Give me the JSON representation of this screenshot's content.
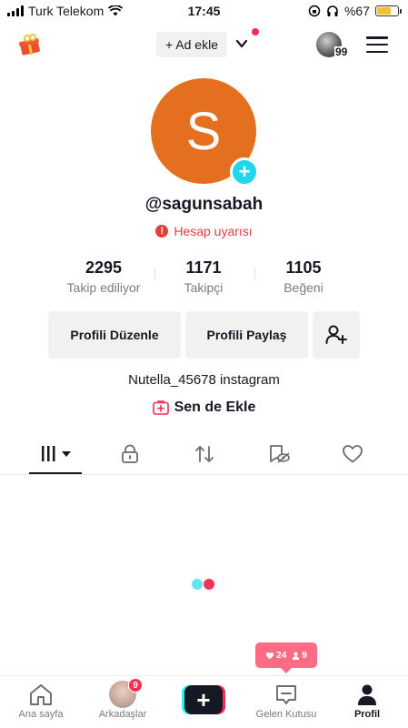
{
  "status_bar": {
    "carrier": "Turk Telekom",
    "time": "17:45",
    "battery_text": "%67",
    "battery_level": 0.67,
    "battery_color": "#f2c230"
  },
  "top_nav": {
    "gift_icon": "gift-icon",
    "add_account_label": "+ Ad ekle",
    "mini_avatar_count": "99"
  },
  "profile": {
    "avatar_initial": "S",
    "avatar_color": "#e4701f",
    "username": "@sagunsabah",
    "warning_label": "Hesap uyarısı",
    "stats": [
      {
        "value": "2295",
        "label": "Takip ediliyor"
      },
      {
        "value": "1171",
        "label": "Takipçi"
      },
      {
        "value": "1105",
        "label": "Beğeni"
      }
    ],
    "edit_button": "Profili Düzenle",
    "share_button": "Profili Paylaş",
    "bio": "Nutella_45678 instagram",
    "add_link": "Sen de Ekle"
  },
  "tabs": [
    "videos-grid-icon",
    "lock-icon",
    "repost-icon",
    "bookmark-eye-icon",
    "heart-icon"
  ],
  "popup": {
    "likes": "24",
    "followers": "9"
  },
  "bottom_nav": {
    "items": [
      {
        "label": "Ana sayfa",
        "icon": "home-icon"
      },
      {
        "label": "Arkadaşlar",
        "icon": "friends-avatar",
        "badge": "9"
      },
      {
        "label": "",
        "icon": "create-plus-icon"
      },
      {
        "label": "Gelen Kutusu",
        "icon": "inbox-icon"
      },
      {
        "label": "Profil",
        "icon": "profile-icon"
      }
    ]
  },
  "colors": {
    "accent_red": "#fe2c55",
    "accent_cyan": "#25f4ee",
    "warning_red": "#e63e3e"
  }
}
